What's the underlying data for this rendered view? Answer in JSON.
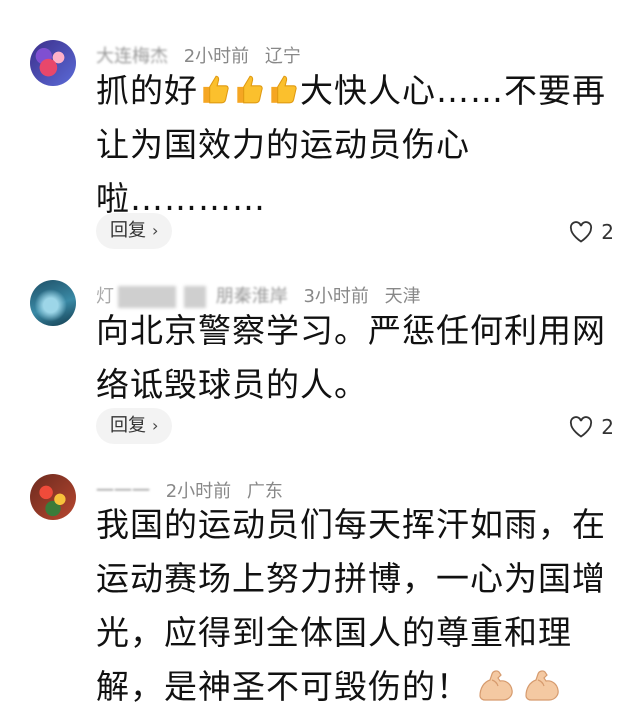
{
  "comments": [
    {
      "name": "大连梅杰",
      "time": "2小时前",
      "location": "辽宁",
      "text_parts": [
        "抓的好",
        "大快人心……不要再让为国效力的运动员伤心啦…………"
      ],
      "emoji": "thumbs-up-icon",
      "reply_label": "回复",
      "likes": "2"
    },
    {
      "name": "灯",
      "name_suffix": "朋秦淮岸",
      "time": "3小时前",
      "location": "天津",
      "text": "向北京警察学习。严惩任何利用网络诋毁球员的人。",
      "reply_label": "回复",
      "likes": "2"
    },
    {
      "name": "一一一",
      "time": "2小时前",
      "location": "广东",
      "text": "我国的运动员们每天挥汗如雨，在运动赛场上努力拼博，一心为国增光，应得到全体国人的尊重和理解，是神圣不可毁伤的！",
      "emoji": "flexed-biceps-icon"
    }
  ],
  "colors": {
    "text": "#111111",
    "meta": "#888888",
    "reply_bg": "#f3f3f3"
  }
}
